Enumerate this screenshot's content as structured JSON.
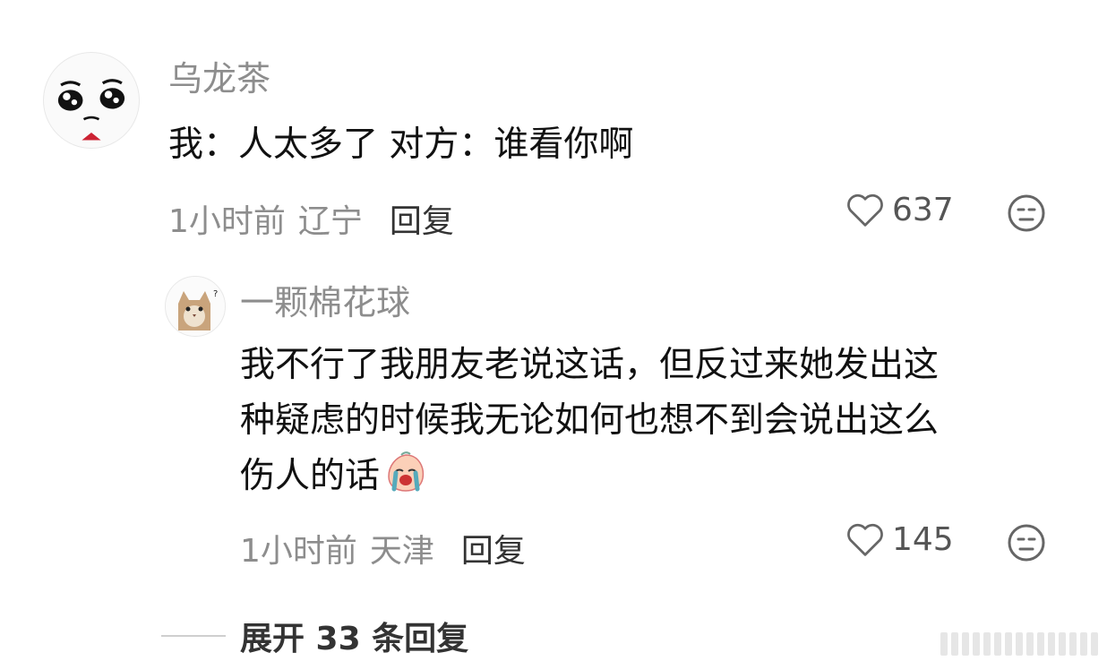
{
  "comments": [
    {
      "username": "乌龙茶",
      "text": "我：人太多了 对方：谁看你啊",
      "time": "1小时前",
      "location": "辽宁",
      "reply_label": "回复",
      "likes": "637",
      "avatar_icon": "crying-cartoon-face-icon"
    }
  ],
  "replies": [
    {
      "username": "一颗棉花球",
      "text_line1": "我不行了我朋友老说这话，但反过来她发出这",
      "text_line2": "种疑虑的时候我无论如何也想不到会说出这么",
      "text_line3": "伤人的话",
      "emoji": "crying-peach-emoji",
      "time": "1小时前",
      "location": "天津",
      "reply_label": "回复",
      "likes": "145",
      "avatar_icon": "cat-avatar-icon"
    }
  ],
  "expand_label": "展开 33 条回复",
  "icons": {
    "like": "heart-outline-icon",
    "dislike": "neutral-face-icon"
  },
  "colors": {
    "username": "#8d8d8d",
    "text": "#111111",
    "meta": "#8d8d8d"
  }
}
